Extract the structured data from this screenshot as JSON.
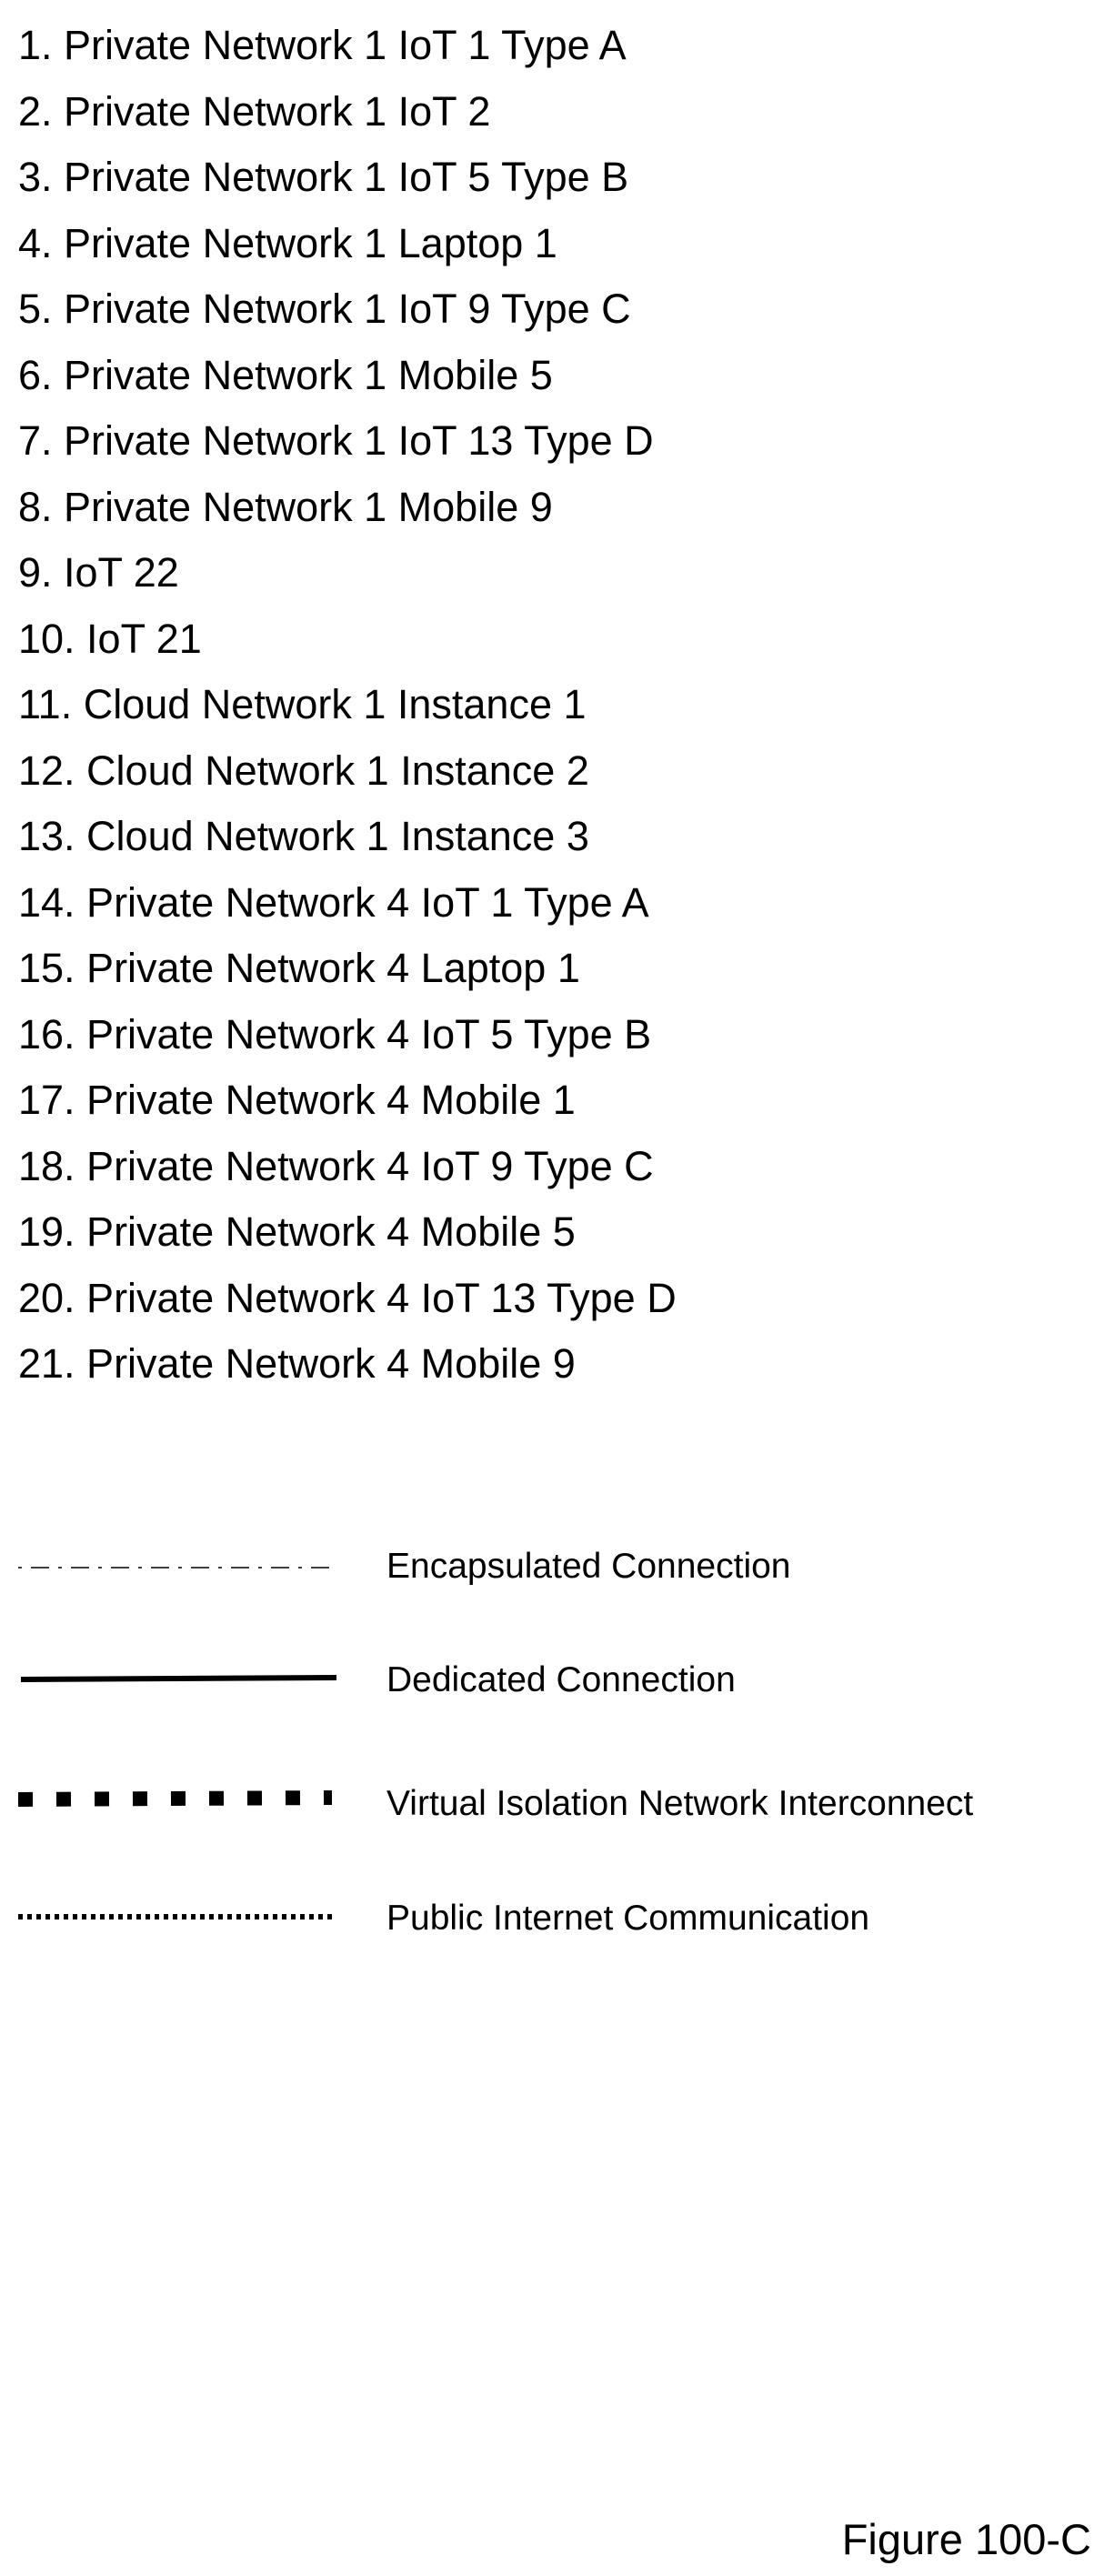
{
  "items": [
    "1. Private Network 1 IoT 1 Type A",
    "2. Private Network 1 IoT 2",
    "3. Private Network 1 IoT 5 Type B",
    "4. Private Network 1 Laptop 1",
    "5. Private Network 1 IoT 9 Type C",
    "6. Private Network 1 Mobile 5",
    "7. Private Network 1 IoT 13 Type D",
    "8. Private Network 1 Mobile 9",
    "9. IoT 22",
    "10. IoT 21",
    "11. Cloud Network 1 Instance 1",
    "12. Cloud Network 1 Instance 2",
    "13. Cloud Network 1 Instance 3",
    "14. Private Network 4 IoT 1 Type A",
    "15. Private Network 4 Laptop 1",
    "16. Private Network 4 IoT 5 Type B",
    "17. Private Network 4 Mobile 1",
    "18. Private Network 4 IoT 9 Type C",
    "19. Private Network 4 Mobile 5",
    "20. Private Network 4 IoT 13 Type D",
    "21. Private Network 4 Mobile 9"
  ],
  "legend": [
    {
      "line_style": "dash-dot",
      "label": "Encapsulated Connection"
    },
    {
      "line_style": "solid-thick",
      "label": "Dedicated Connection"
    },
    {
      "line_style": "block-dashed",
      "label": "Virtual Isolation Network Interconnect"
    },
    {
      "line_style": "dotted",
      "label": "Public Internet Communication"
    }
  ],
  "figure_label": "Figure 100-C"
}
